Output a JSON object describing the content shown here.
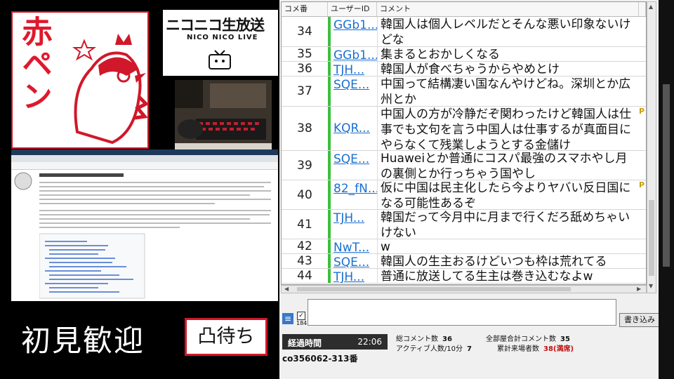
{
  "overlay": {
    "logo_text": "赤ペン",
    "nico_banner_title": "ニコニコ生放送",
    "nico_banner_sub": "NICO NICO LIVE",
    "caption_welcome": "初見歓迎",
    "badge_totsu": "凸待ち"
  },
  "comment_grid": {
    "headers": {
      "number": "コメ番",
      "user_id": "ユーザーID",
      "comment": "コメント"
    },
    "rows": [
      {
        "number": "34",
        "user": "GGb1...",
        "comment": "韓国人は個人レベルだとそんな悪い印象ないけどな",
        "marker": ""
      },
      {
        "number": "35",
        "user": "GGb1...",
        "comment": "集まるとおかしくなる",
        "marker": ""
      },
      {
        "number": "36",
        "user": "TJH...",
        "comment": "韓国人が食べちゃうからやめとけ",
        "marker": ""
      },
      {
        "number": "37",
        "user": "SQE...",
        "comment": "中国って結構凄い国なんやけどね。深圳とか広州とか",
        "marker": ""
      },
      {
        "number": "38",
        "user": "KQR...",
        "comment": "中国人の方が冷静だぞ関わったけど韓国人は仕事でも文句を言う中国人は仕事するが真面目にやらなくて残業しようとする金儲け",
        "marker": "P"
      },
      {
        "number": "39",
        "user": "SQE...",
        "comment": "Huaweiとか普通にコスパ最強のスマホやし月の裏側とか行っちゃう国やし",
        "marker": ""
      },
      {
        "number": "40",
        "user": "82_fN...",
        "comment": "仮に中国は民主化したら今よりヤバい反日国になる可能性あるぞ",
        "marker": "P"
      },
      {
        "number": "41",
        "user": "TJH...",
        "comment": "韓国だって今月中に月まで行くだろ舐めちゃいけない",
        "marker": ""
      },
      {
        "number": "42",
        "user": "NwT...",
        "comment": "w",
        "marker": ""
      },
      {
        "number": "43",
        "user": "SQE...",
        "comment": "韓国人の生主おるけどいつも枠は荒れてる",
        "marker": ""
      },
      {
        "number": "44",
        "user": "TJH...",
        "comment": "普通に放送してる生主は巻き込むなよw",
        "marker": ""
      }
    ]
  },
  "input": {
    "checkbox_label": "184",
    "submit_label": "書き込み"
  },
  "stats": {
    "elapsed_label": "経過時間",
    "elapsed_value": "22:06",
    "total_comments_label": "総コメント数",
    "total_comments_value": "36",
    "active_label": "アクティブ人数/10分",
    "active_value": "7",
    "all_rooms_label": "全部屋合計コメント数",
    "all_rooms_value": "35",
    "visitors_label": "累計来場者数",
    "visitors_value": "38",
    "visitors_note": "(満席)",
    "community_id": "co356062-313番"
  },
  "colors": {
    "accent_red": "#d0182a",
    "user_link": "#1a6fd0",
    "user_stripe": "#3cbf3c"
  }
}
